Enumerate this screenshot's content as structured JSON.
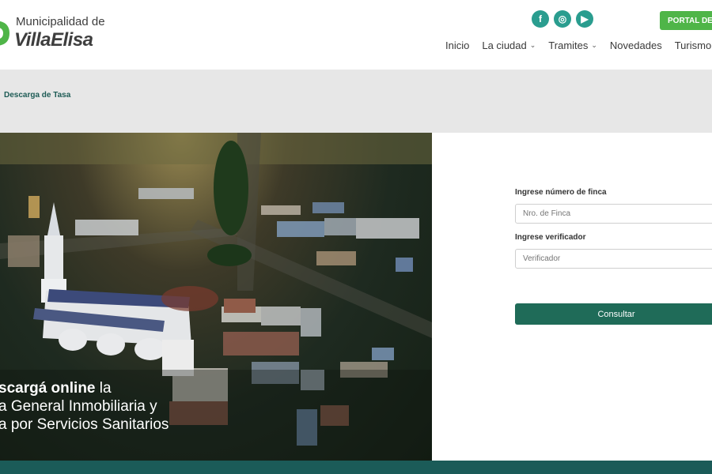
{
  "header": {
    "logo_top": "Municipalidad de",
    "logo_bottom": "VillaElisa",
    "portal_button": "PORTAL DEL E",
    "socials": [
      {
        "icon": "facebook-icon",
        "glyph": "f"
      },
      {
        "icon": "instagram-icon",
        "glyph": "◎"
      },
      {
        "icon": "youtube-icon",
        "glyph": "▶"
      }
    ],
    "nav": [
      {
        "label": "Inicio",
        "has_dropdown": false
      },
      {
        "label": "La ciudad",
        "has_dropdown": true
      },
      {
        "label": "Tramites",
        "has_dropdown": true
      },
      {
        "label": "Novedades",
        "has_dropdown": false
      },
      {
        "label": "Turismo",
        "has_dropdown": false
      }
    ]
  },
  "breadcrumb": {
    "current": "Descarga de Tasa"
  },
  "hero": {
    "line1_bold": "scargá online",
    "line1_rest": " la",
    "line2": "a General Inmobiliaria y",
    "line3": "a por Servicios Sanitarios"
  },
  "form": {
    "finca_label": "Ingrese número de finca",
    "finca_placeholder": "Nro. de Finca",
    "verificador_label": "Ingrese verificador",
    "verificador_placeholder": "Verificador",
    "submit_label": "Consultar"
  },
  "colors": {
    "brand_green": "#4fb548",
    "social_teal": "#2a9d8f",
    "button_green": "#1f6b58",
    "footer": "#1b5b58",
    "band": "#e7e7e7"
  }
}
